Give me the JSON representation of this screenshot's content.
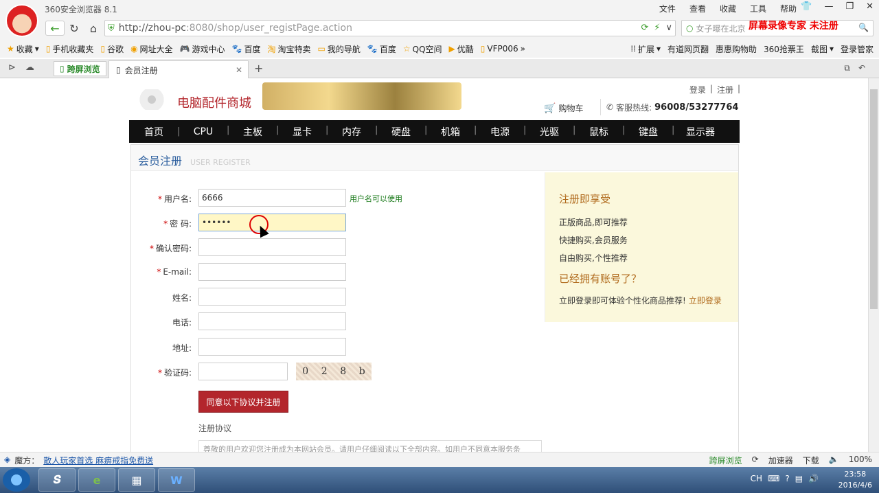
{
  "browser": {
    "title": "360安全浏览器 8.1",
    "menu": [
      "文件",
      "查看",
      "收藏",
      "工具",
      "帮助"
    ],
    "url_host": "http://zhou-pc",
    "url_rest": ":8080/shop/user_registPage.action",
    "search_placeholder": "女子曝在北京",
    "recording_watermark": "屏幕录像专家  未注册",
    "bookmarks": [
      "收藏",
      "手机收藏夹",
      "谷歌",
      "网址大全",
      "游戏中心",
      "百度",
      "淘宝特卖",
      "我的导航",
      "百度",
      "QQ空间",
      "优酷",
      "VFP006"
    ],
    "bookmarks_right": [
      "扩展",
      "有道网页翻",
      "惠惠购物助",
      "360抢票王",
      "截图",
      "登录管家"
    ],
    "tab_split_label": "跨屏浏览",
    "tab_active_label": "会员注册"
  },
  "site": {
    "name": "电脑配件商城",
    "login": "登录",
    "register": "注册",
    "cart": "购物车",
    "hotline_label": "客服热线:",
    "hotline": "96008/53277764",
    "nav": [
      "首页",
      "CPU",
      "主板",
      "显卡",
      "内存",
      "硬盘",
      "机箱",
      "电源",
      "光驱",
      "鼠标",
      "键盘",
      "显示器"
    ]
  },
  "form": {
    "title": "会员注册",
    "title_en": "USER REGISTER",
    "username_label": "用户名:",
    "username_value": "6666",
    "username_hint": "用户名可以使用",
    "password_label": "密  码:",
    "password_value": "••••••",
    "confirm_label": "确认密码:",
    "email_label": "E-mail:",
    "name_label": "姓名:",
    "phone_label": "电话:",
    "address_label": "地址:",
    "captcha_label": "验证码:",
    "captcha_chars": [
      "0",
      "2",
      "8",
      "b"
    ],
    "submit": "同意以下协议并注册",
    "agreement_label": "注册协议",
    "agreement_text": "尊敬的用户欢迎您注册成为本网站会员。请用户仔细阅读以下全部内容。如用户不同意本服务条"
  },
  "benefits": {
    "title": "注册即享受",
    "items": [
      "正版商品,即可推荐",
      "快捷购买,会员服务",
      "自由购买,个性推荐"
    ],
    "have_account": "已经拥有账号了？",
    "login_prompt": "立即登录即可体验个性化商品推荐!",
    "login_link": "立即登录"
  },
  "status": {
    "left_label": "魔方：",
    "left_link": "散人玩家首选 麻痹戒指免费送",
    "right": [
      "跨屏浏览",
      "加速器",
      "下载",
      "100%"
    ]
  },
  "taskbar": {
    "lang": "CH",
    "time": "23:58",
    "date": "2016/4/6"
  }
}
